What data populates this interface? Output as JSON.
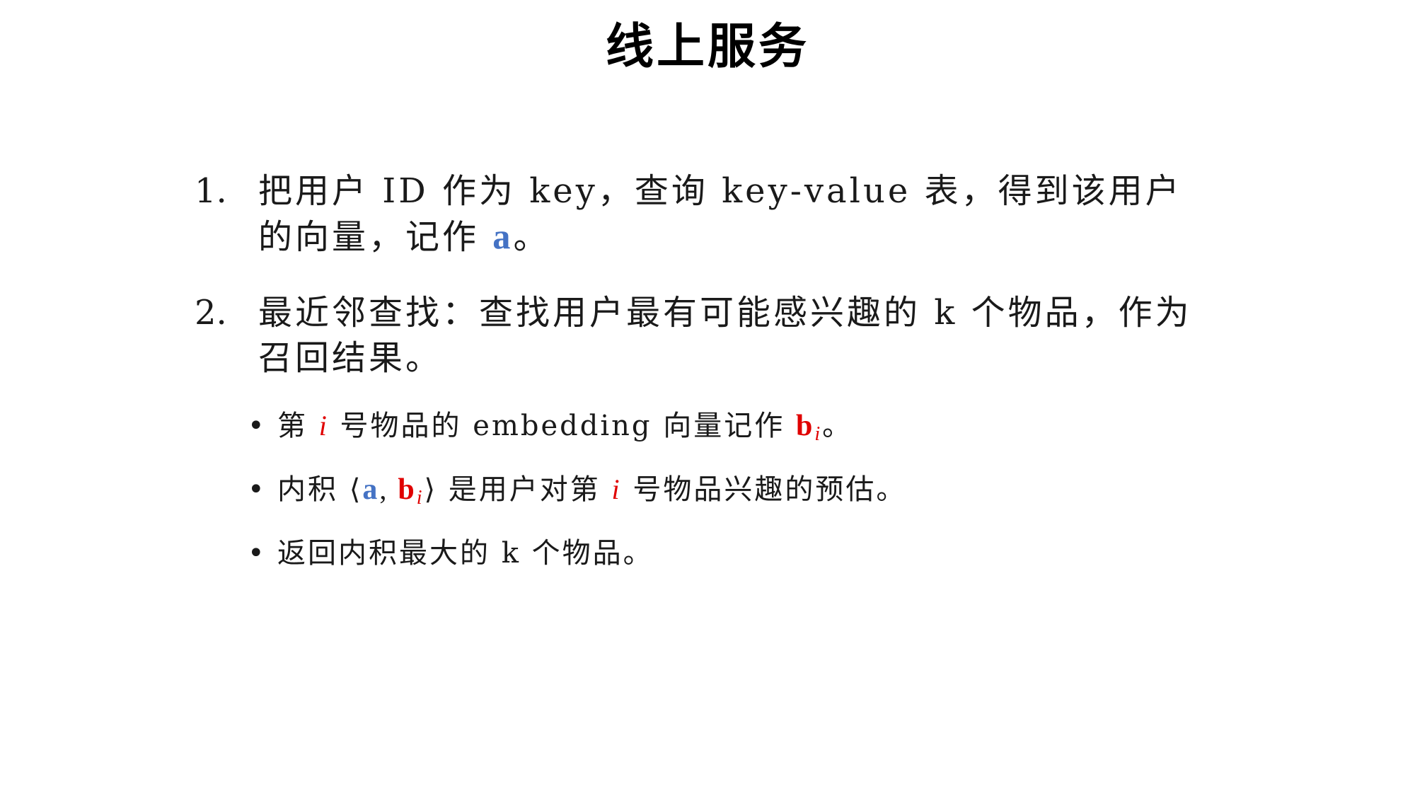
{
  "slide": {
    "title": "线上服务"
  },
  "steps": [
    {
      "number": "1.",
      "text_before": "把用户 ID 作为 key，查询 key-value 表，得到该用户的向量，记作 ",
      "vector": "a",
      "text_after": "。"
    },
    {
      "number": "2.",
      "text": "最近邻查找：查找用户最有可能感兴趣的 k 个物品，作为召回结果。"
    }
  ],
  "bullets": [
    {
      "marker": "•",
      "text_before": "第 ",
      "index": "i",
      "text_middle": " 号物品的 embedding 向量记作 ",
      "vector": "b",
      "subscript": "i",
      "text_after": "。"
    },
    {
      "marker": "•",
      "text_before": "内积 ",
      "bracket_open": "⟨",
      "vector_a": "a",
      "comma": ", ",
      "vector_b": "b",
      "subscript": "i",
      "bracket_close": "⟩",
      "text_middle": " 是用户对第 ",
      "index": "i",
      "text_after": " 号物品兴趣的预估。"
    },
    {
      "marker": "•",
      "text": "返回内积最大的 k 个物品。"
    }
  ],
  "colors": {
    "vector_a": "#4472c4",
    "vector_b": "#e00000",
    "index": "#e00000",
    "text": "#1a1a1a"
  }
}
